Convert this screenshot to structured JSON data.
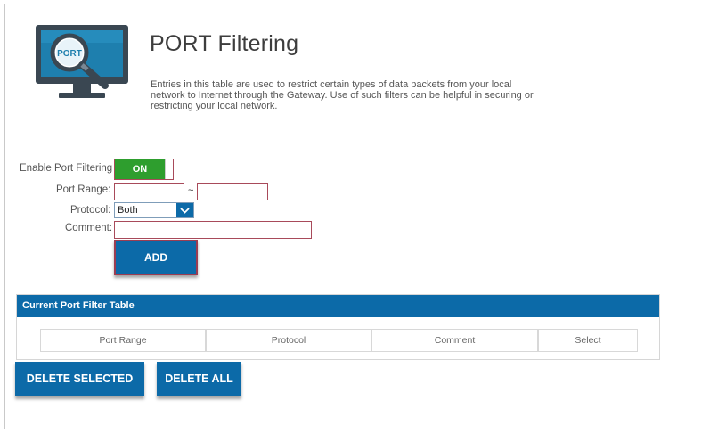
{
  "header": {
    "logo_text": "PORT",
    "title": "PORT Filtering",
    "description": "Entries in this table are used to restrict certain types of data packets from your local network to Internet through the Gateway. Use of such filters can be helpful in securing or restricting your local network."
  },
  "form": {
    "enable_label": "Enable Port Filtering",
    "toggle_state": "ON",
    "port_range_label": "Port Range:",
    "port_range_start": "",
    "port_range_separator": "~",
    "port_range_end": "",
    "protocol_label": "Protocol:",
    "protocol_value": "Both",
    "comment_label": "Comment:",
    "comment_value": "",
    "add_label": "ADD"
  },
  "table": {
    "title": "Current Port Filter Table",
    "columns": [
      "Port Range",
      "Protocol",
      "Comment",
      "Select"
    ],
    "rows": []
  },
  "actions": {
    "delete_selected_label": "DELETE SELECTED",
    "delete_all_label": "DELETE ALL"
  },
  "colors": {
    "accent_blue": "#0c6aa8",
    "toggle_green": "#2e9e2e",
    "field_border": "#a84a5a"
  }
}
